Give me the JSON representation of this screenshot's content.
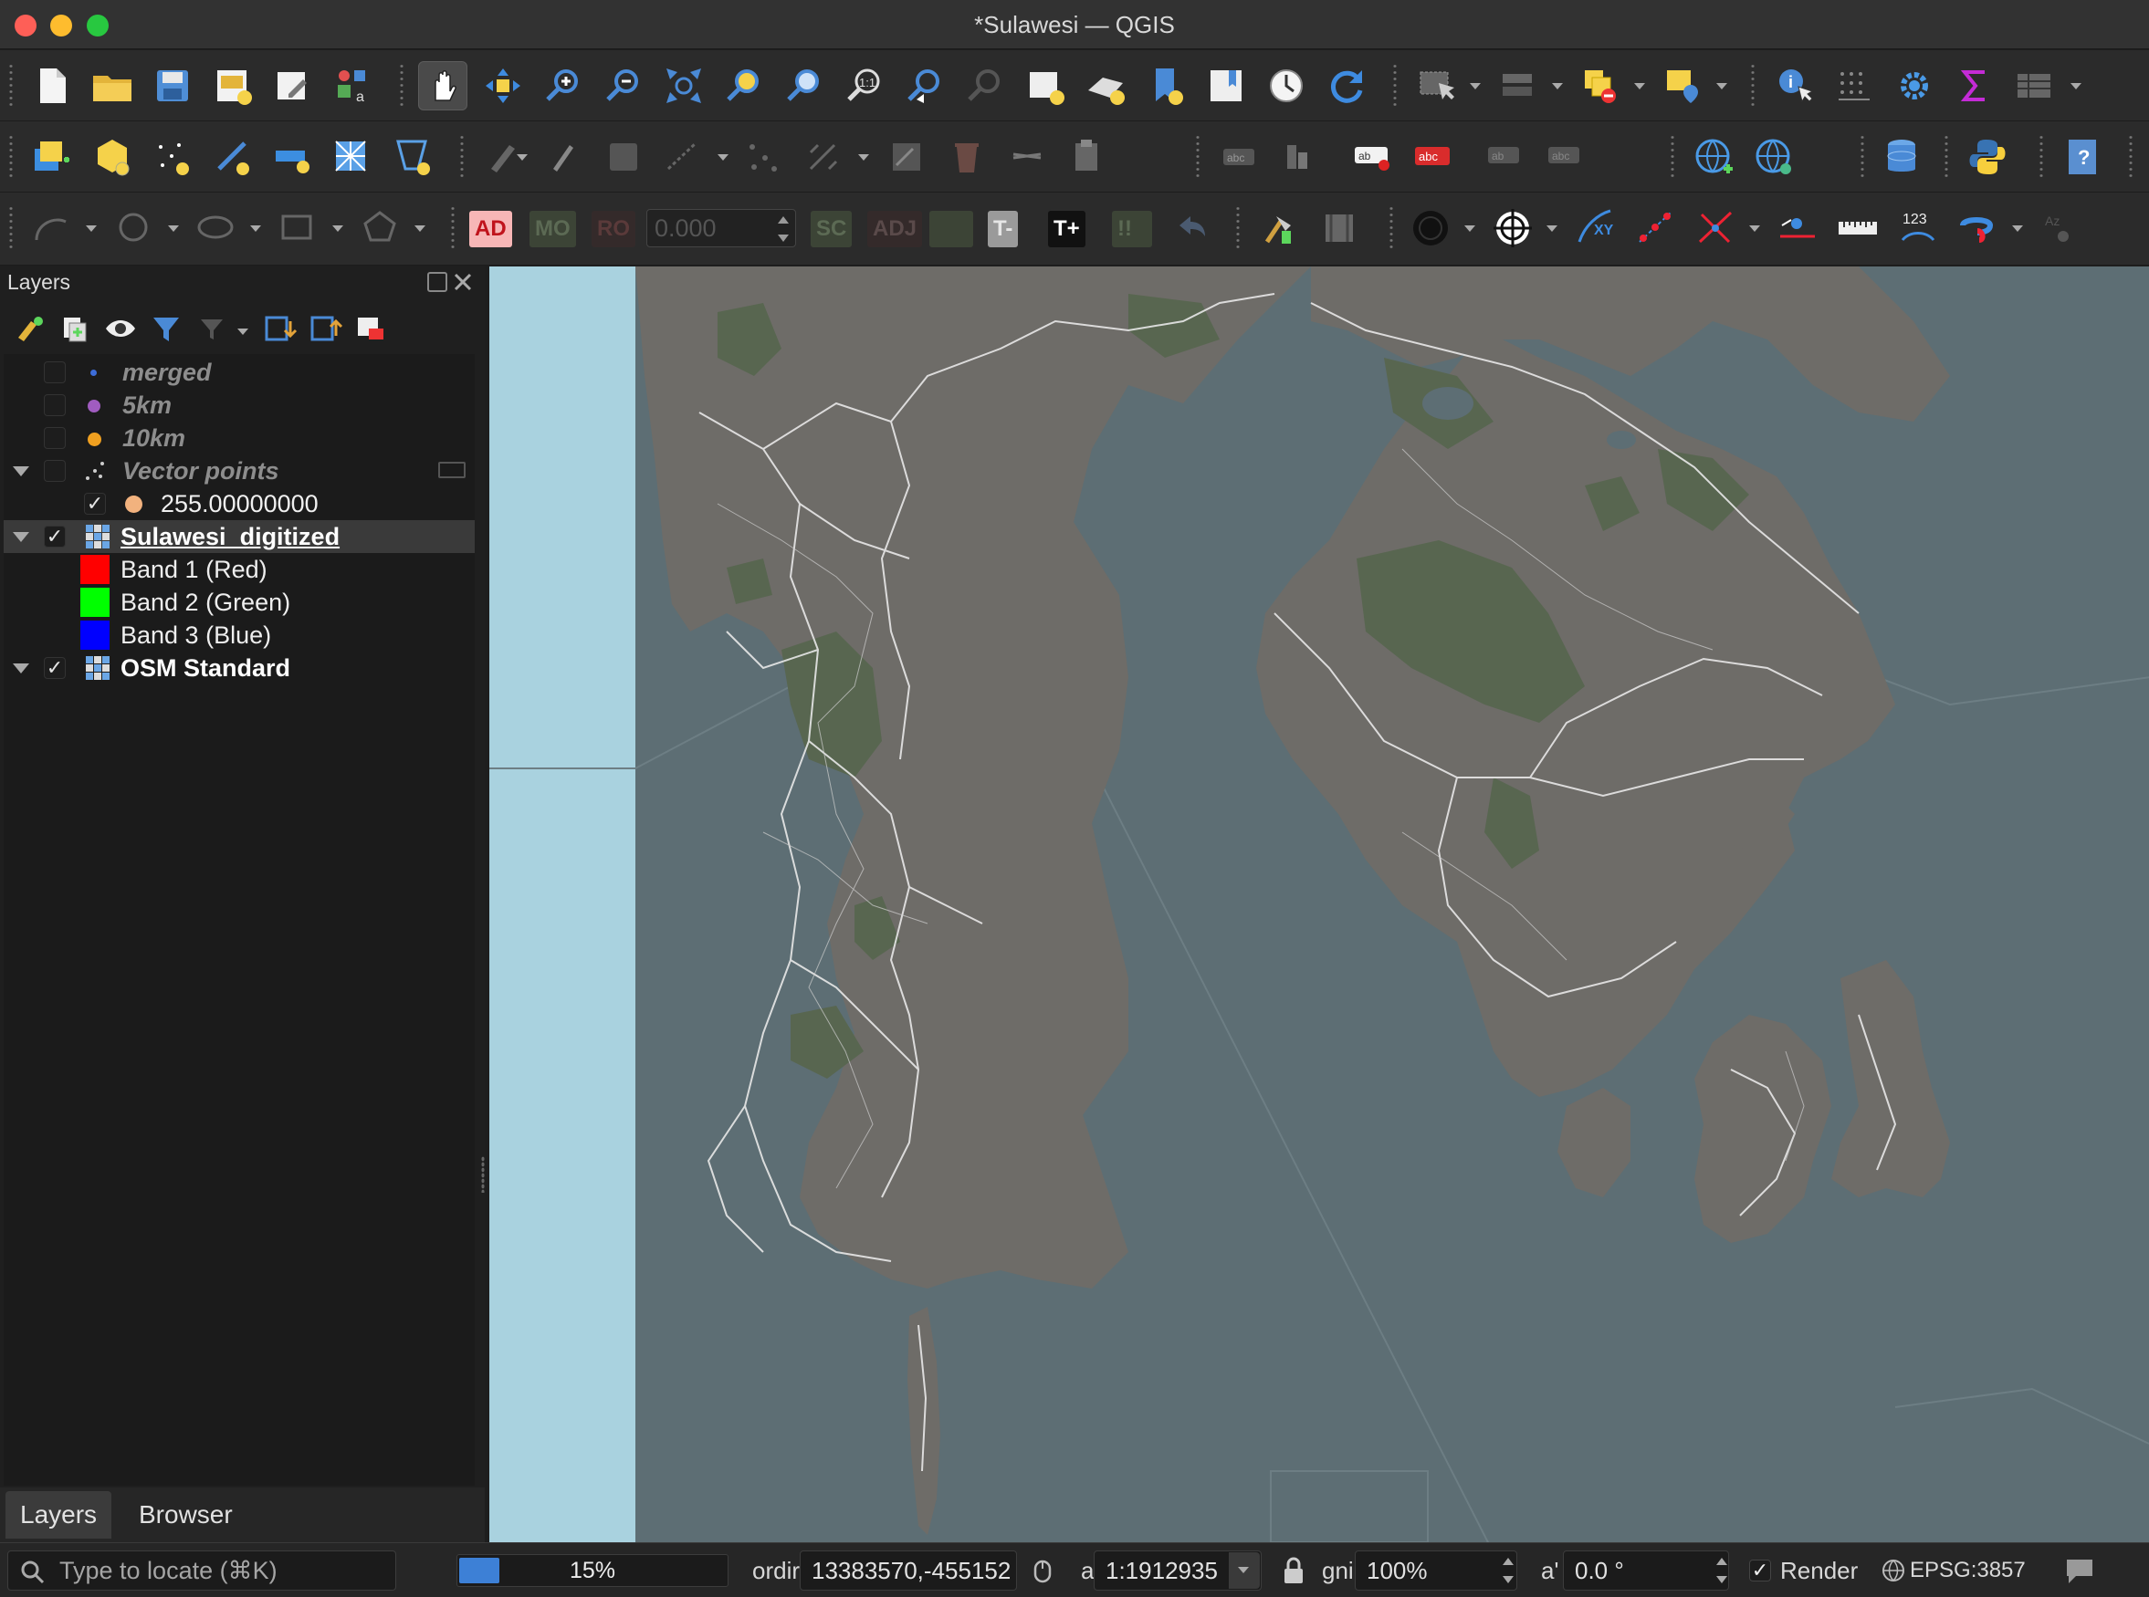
{
  "window": {
    "title": "*Sulawesi — QGIS"
  },
  "toolbar3": {
    "ad": "AD",
    "mo": "MO",
    "ro": "RO",
    "offset_value": "0.000",
    "sc": "SC",
    "adj": "ADJ",
    "t_minus": "T-",
    "t_plus": "T+",
    "xy": "XY",
    "num": "123"
  },
  "layers_panel": {
    "title": "Layers",
    "items": [
      {
        "label": "merged",
        "style": "italic",
        "checked": false,
        "symbol": "dot",
        "color": "#3d6dd9"
      },
      {
        "label": "5km",
        "style": "italic",
        "checked": false,
        "symbol": "dot",
        "color": "#a05cc0"
      },
      {
        "label": "10km",
        "style": "italic",
        "checked": false,
        "symbol": "dot",
        "color": "#f0a020"
      },
      {
        "label": "Vector points",
        "style": "italic",
        "checked": false,
        "symbol": "points",
        "expanded": true
      },
      {
        "label": "255.00000000",
        "style": "normal",
        "checked": true,
        "symbol": "dot",
        "color": "#f2b27e"
      },
      {
        "label": "Sulawesi_digitized",
        "style": "bold-underline",
        "checked": true,
        "symbol": "raster",
        "expanded": true,
        "selected": true
      },
      {
        "label": "Band 1 (Red)",
        "style": "normal",
        "symbol": "swatch",
        "color": "#ff0000"
      },
      {
        "label": "Band 2 (Green)",
        "style": "normal",
        "symbol": "swatch",
        "color": "#00ff00"
      },
      {
        "label": "Band 3 (Blue)",
        "style": "normal",
        "symbol": "swatch",
        "color": "#0000ff"
      },
      {
        "label": "OSM Standard",
        "style": "bold",
        "checked": true,
        "symbol": "raster",
        "expanded": true
      }
    ],
    "tabs": [
      {
        "label": "Layers",
        "active": true
      },
      {
        "label": "Browser",
        "active": false
      }
    ]
  },
  "statusbar": {
    "locate_placeholder": "Type to locate (⌘K)",
    "progress_text": "15%",
    "progress_value": 0.15,
    "coord_label": "ordir",
    "coordinate": "13383570,-455152",
    "scale_label": "a",
    "scale": "1:1912935",
    "magnifier_label": "gni",
    "magnifier": "100%",
    "rotation_label": "a'",
    "rotation": "0.0 °",
    "render_label": "Render",
    "crs": "EPSG:3857"
  },
  "colors": {
    "sea": "#5d6e74",
    "land": "#6e6c68",
    "forest": "#586650",
    "light_sea": "#a9d2df",
    "selection": "#3a3a3a",
    "accent": "#3d80d6"
  }
}
